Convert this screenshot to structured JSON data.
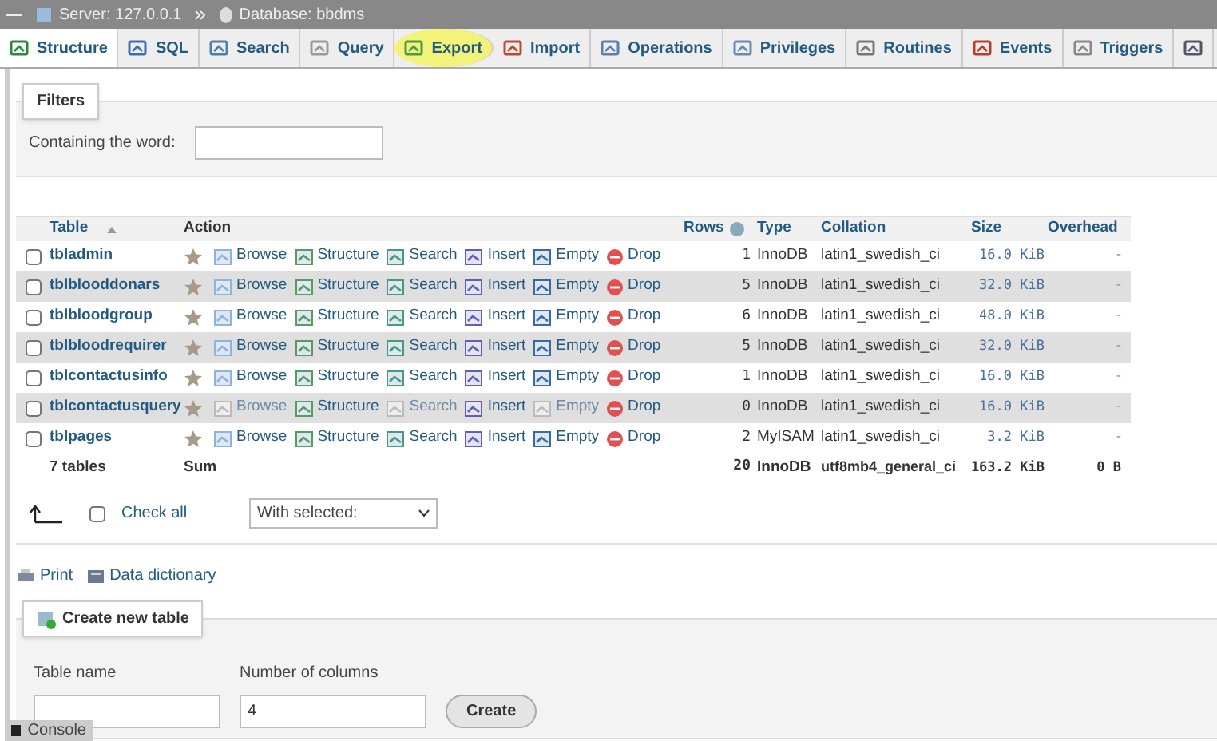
{
  "breadcrumb": [
    {
      "kind": "server",
      "label": "Server: 127.0.0.1"
    },
    {
      "kind": "database",
      "label": "Database: bbdms"
    }
  ],
  "tabs": [
    {
      "kind": "structure",
      "label": "Structure",
      "selected": true,
      "highlighted": false
    },
    {
      "kind": "sql",
      "label": "SQL",
      "selected": false,
      "highlighted": false
    },
    {
      "kind": "search",
      "label": "Search",
      "selected": false,
      "highlighted": false
    },
    {
      "kind": "query",
      "label": "Query",
      "selected": false,
      "highlighted": false
    },
    {
      "kind": "export",
      "label": "Export",
      "selected": false,
      "highlighted": true
    },
    {
      "kind": "import",
      "label": "Import",
      "selected": false,
      "highlighted": false
    },
    {
      "kind": "operations",
      "label": "Operations",
      "selected": false,
      "highlighted": false
    },
    {
      "kind": "privileges",
      "label": "Privileges",
      "selected": false,
      "highlighted": false
    },
    {
      "kind": "routines",
      "label": "Routines",
      "selected": false,
      "highlighted": false
    },
    {
      "kind": "events",
      "label": "Events",
      "selected": false,
      "highlighted": false
    },
    {
      "kind": "triggers",
      "label": "Triggers",
      "selected": false,
      "highlighted": false
    },
    {
      "kind": "more",
      "selected": false,
      "highlighted": false
    }
  ],
  "filters": {
    "legend": "Filters",
    "label": "Containing the word:"
  },
  "table": {
    "columns": [
      "Table",
      "Action",
      "Rows",
      "Type",
      "Collation",
      "Size",
      "Overhead"
    ],
    "rows": [
      {
        "name": "tbladmin",
        "checked": false,
        "actions": [
          {
            "kind": "browse",
            "label": "Browse",
            "disabled": false
          },
          {
            "kind": "structure",
            "label": "Structure",
            "disabled": false
          },
          {
            "kind": "search",
            "label": "Search",
            "disabled": false
          },
          {
            "kind": "insert",
            "label": "Insert",
            "disabled": false
          },
          {
            "kind": "empty",
            "label": "Empty",
            "disabled": false
          },
          {
            "kind": "drop",
            "label": "Drop",
            "disabled": false
          }
        ],
        "rows": "1",
        "type": "InnoDB",
        "collation": "latin1_swedish_ci",
        "size": "16.0 KiB",
        "overhead": "-"
      },
      {
        "name": "tblblooddonars",
        "checked": false,
        "actions": [
          {
            "kind": "browse",
            "label": "Browse",
            "disabled": false
          },
          {
            "kind": "structure",
            "label": "Structure",
            "disabled": false
          },
          {
            "kind": "search",
            "label": "Search",
            "disabled": false
          },
          {
            "kind": "insert",
            "label": "Insert",
            "disabled": false
          },
          {
            "kind": "empty",
            "label": "Empty",
            "disabled": false
          },
          {
            "kind": "drop",
            "label": "Drop",
            "disabled": false
          }
        ],
        "rows": "5",
        "type": "InnoDB",
        "collation": "latin1_swedish_ci",
        "size": "32.0 KiB",
        "overhead": "-"
      },
      {
        "name": "tblbloodgroup",
        "checked": false,
        "actions": [
          {
            "kind": "browse",
            "label": "Browse",
            "disabled": false
          },
          {
            "kind": "structure",
            "label": "Structure",
            "disabled": false
          },
          {
            "kind": "search",
            "label": "Search",
            "disabled": false
          },
          {
            "kind": "insert",
            "label": "Insert",
            "disabled": false
          },
          {
            "kind": "empty",
            "label": "Empty",
            "disabled": false
          },
          {
            "kind": "drop",
            "label": "Drop",
            "disabled": false
          }
        ],
        "rows": "6",
        "type": "InnoDB",
        "collation": "latin1_swedish_ci",
        "size": "48.0 KiB",
        "overhead": "-"
      },
      {
        "name": "tblbloodrequirer",
        "checked": false,
        "actions": [
          {
            "kind": "browse",
            "label": "Browse",
            "disabled": false
          },
          {
            "kind": "structure",
            "label": "Structure",
            "disabled": false
          },
          {
            "kind": "search",
            "label": "Search",
            "disabled": false
          },
          {
            "kind": "insert",
            "label": "Insert",
            "disabled": false
          },
          {
            "kind": "empty",
            "label": "Empty",
            "disabled": false
          },
          {
            "kind": "drop",
            "label": "Drop",
            "disabled": false
          }
        ],
        "rows": "5",
        "type": "InnoDB",
        "collation": "latin1_swedish_ci",
        "size": "32.0 KiB",
        "overhead": "-"
      },
      {
        "name": "tblcontactusinfo",
        "checked": false,
        "actions": [
          {
            "kind": "browse",
            "label": "Browse",
            "disabled": false
          },
          {
            "kind": "structure",
            "label": "Structure",
            "disabled": false
          },
          {
            "kind": "search",
            "label": "Search",
            "disabled": false
          },
          {
            "kind": "insert",
            "label": "Insert",
            "disabled": false
          },
          {
            "kind": "empty",
            "label": "Empty",
            "disabled": false
          },
          {
            "kind": "drop",
            "label": "Drop",
            "disabled": false
          }
        ],
        "rows": "1",
        "type": "InnoDB",
        "collation": "latin1_swedish_ci",
        "size": "16.0 KiB",
        "overhead": "-"
      },
      {
        "name": "tblcontactusquery",
        "checked": false,
        "actions": [
          {
            "kind": "browse",
            "label": "Browse",
            "disabled": true
          },
          {
            "kind": "structure",
            "label": "Structure",
            "disabled": false
          },
          {
            "kind": "search",
            "label": "Search",
            "disabled": true
          },
          {
            "kind": "insert",
            "label": "Insert",
            "disabled": false
          },
          {
            "kind": "empty",
            "label": "Empty",
            "disabled": true
          },
          {
            "kind": "drop",
            "label": "Drop",
            "disabled": false
          }
        ],
        "rows": "0",
        "type": "InnoDB",
        "collation": "latin1_swedish_ci",
        "size": "16.0 KiB",
        "overhead": "-"
      },
      {
        "name": "tblpages",
        "checked": false,
        "actions": [
          {
            "kind": "browse",
            "label": "Browse",
            "disabled": false
          },
          {
            "kind": "structure",
            "label": "Structure",
            "disabled": false
          },
          {
            "kind": "search",
            "label": "Search",
            "disabled": false
          },
          {
            "kind": "insert",
            "label": "Insert",
            "disabled": false
          },
          {
            "kind": "empty",
            "label": "Empty",
            "disabled": false
          },
          {
            "kind": "drop",
            "label": "Drop",
            "disabled": false
          }
        ],
        "rows": "2",
        "type": "MyISAM",
        "collation": "latin1_swedish_ci",
        "size": "3.2 KiB",
        "overhead": "-"
      }
    ],
    "footer": {
      "count": "7 tables",
      "sum": "Sum",
      "rows": "20",
      "type": "InnoDB",
      "collation": "utf8mb4_general_ci",
      "size": "163.2 KiB",
      "overhead": "0 B"
    }
  },
  "check_all": {
    "label": "Check all",
    "checked": false
  },
  "with_selected": "With selected:",
  "links": [
    {
      "kind": "print",
      "label": "Print"
    },
    {
      "kind": "dictionary",
      "label": "Data dictionary"
    }
  ],
  "create": {
    "legend": "Create new table",
    "name_label": "Table name",
    "columns_label": "Number of columns",
    "columns_value": "4",
    "button": "Create"
  },
  "console": "Console"
}
